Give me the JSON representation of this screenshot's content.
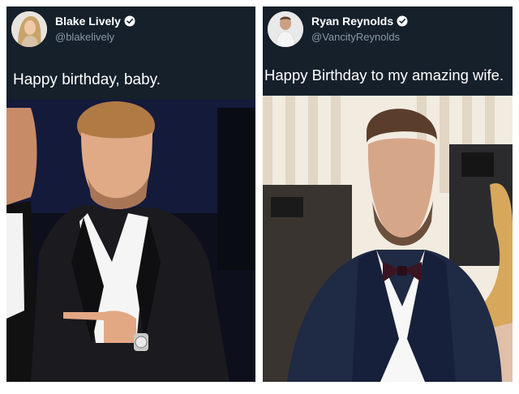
{
  "tweets": [
    {
      "display_name": "Blake Lively",
      "handle": "@blakelively",
      "verified": true,
      "text": "Happy birthday, baby.",
      "photo_icon": "photo-of-man-in-tuxedo-pointing-at-watch"
    },
    {
      "display_name": "Ryan Reynolds",
      "handle": "@VancityReynolds",
      "verified": true,
      "text": "Happy Birthday to my amazing wife.",
      "photo_icon": "photo-of-man-in-tuxedo-with-bow-tie"
    }
  ],
  "colors": {
    "background": "#15202b",
    "text": "#ffffff",
    "handle": "#8899a6",
    "verified": "#ffffff"
  }
}
